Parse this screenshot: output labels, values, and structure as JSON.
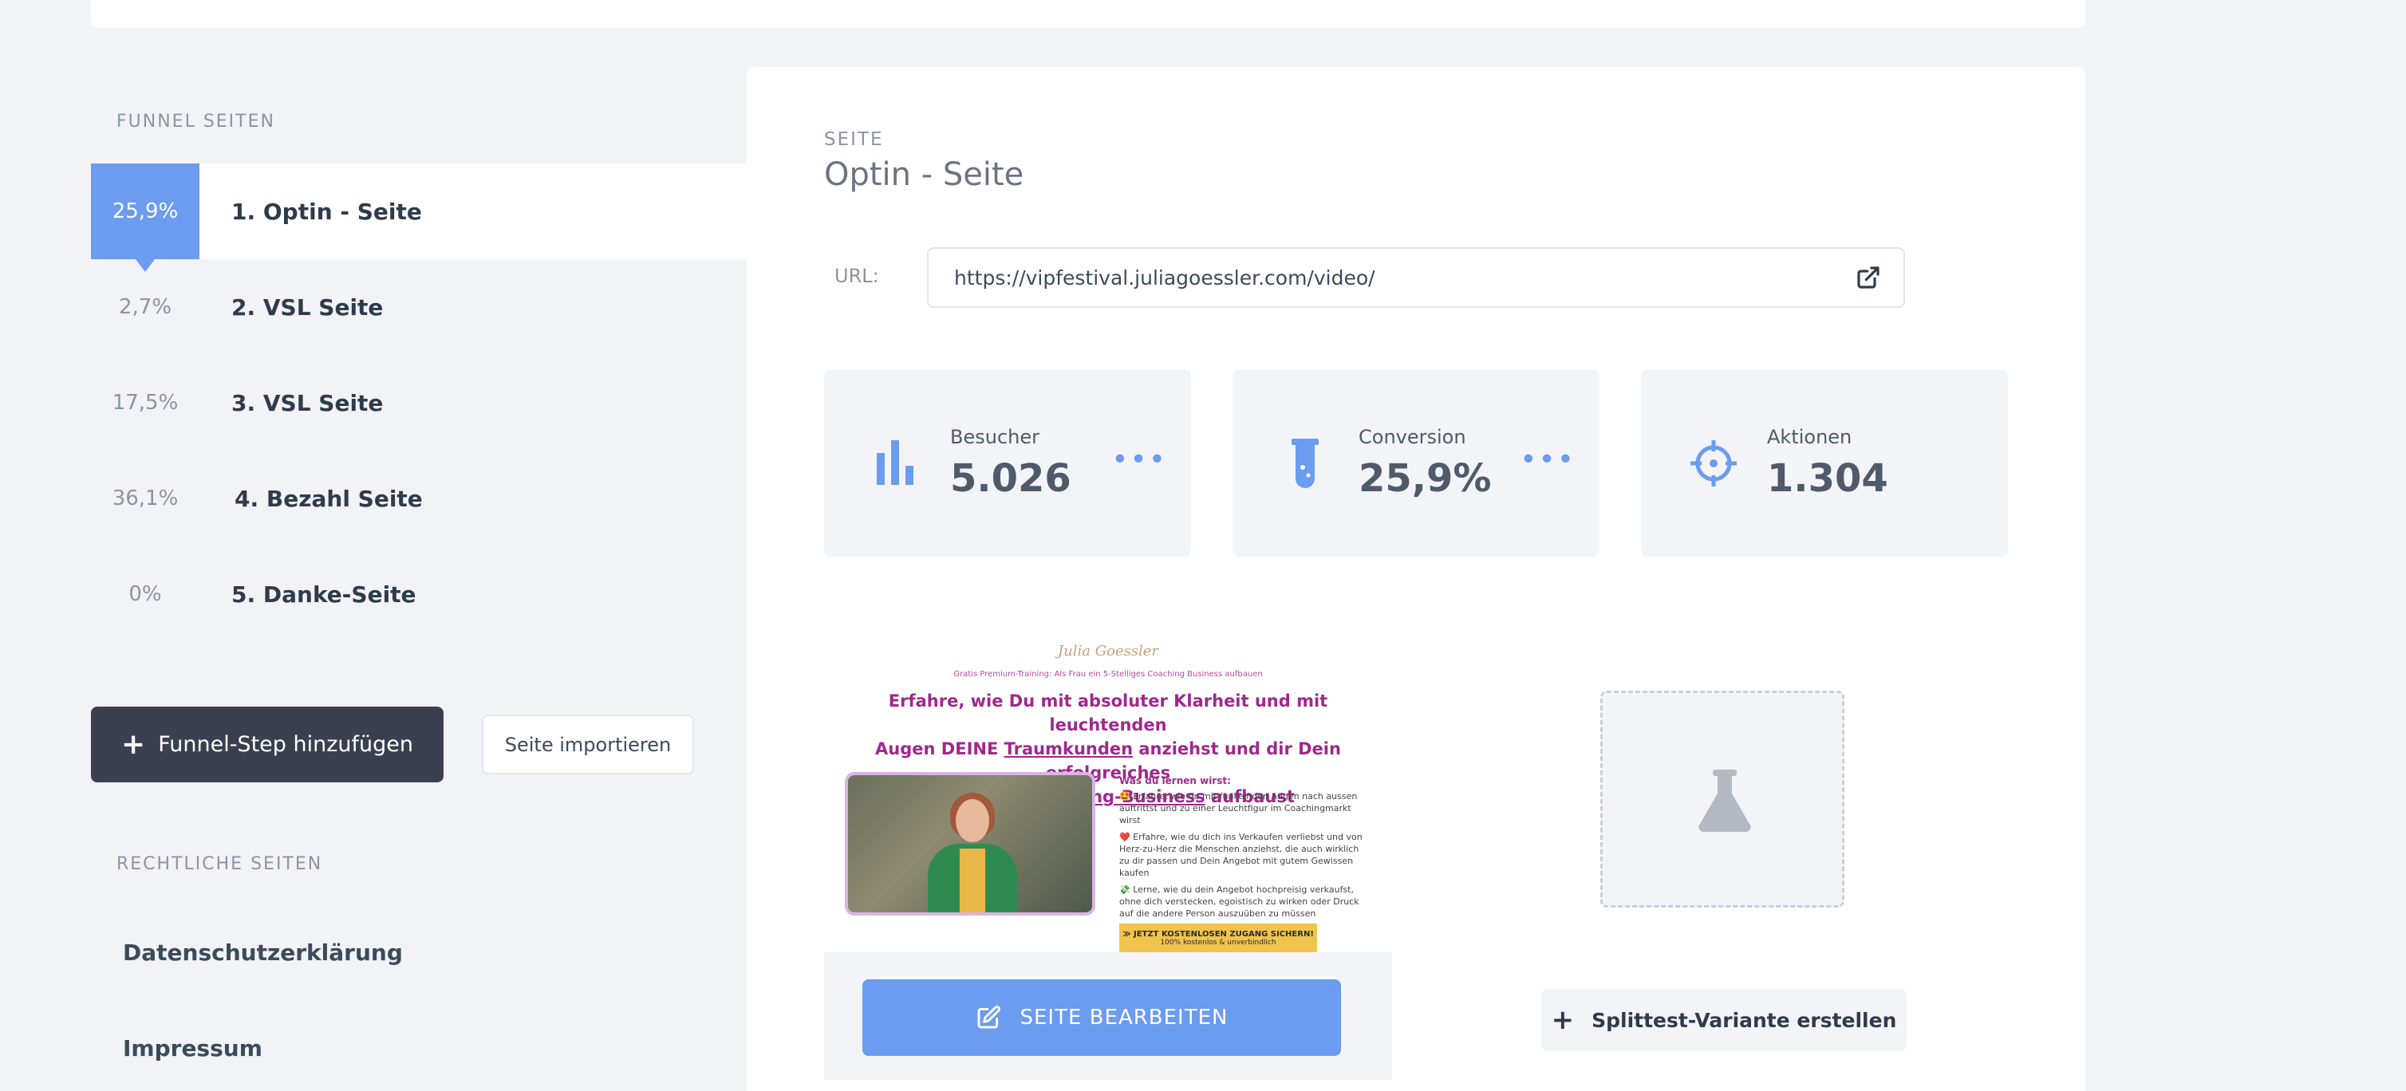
{
  "sidebar": {
    "funnel_section_label": "FUNNEL SEITEN",
    "funnel_items": [
      {
        "pct": "25,9%",
        "label": "1. Optin - Seite"
      },
      {
        "pct": "2,7%",
        "label": "2. VSL Seite"
      },
      {
        "pct": "17,5%",
        "label": "3. VSL Seite"
      },
      {
        "pct": "36,1%",
        "label": "4. Bezahl Seite"
      },
      {
        "pct": "0%",
        "label": "5. Danke-Seite"
      }
    ],
    "add_step_label": "Funnel-Step hinzufügen",
    "import_label": "Seite importieren",
    "legal_section_label": "RECHTLICHE SEITEN",
    "legal_items": [
      "Datenschutzerklärung",
      "Impressum"
    ]
  },
  "main": {
    "kicker": "SEITE",
    "title": "Optin - Seite",
    "url_label": "URL:",
    "url_value": "https://vipfestival.juliagoessler.com/video/",
    "stats": [
      {
        "label": "Besucher",
        "value": "5.026",
        "icon": "bar-chart-icon"
      },
      {
        "label": "Conversion",
        "value": "25,9%",
        "icon": "test-tube-icon"
      },
      {
        "label": "Aktionen",
        "value": "1.304",
        "icon": "crosshair-icon"
      }
    ],
    "edit_label": "SEITE BEARBEITEN",
    "split_label": "Splittest-Variante erstellen",
    "accent_color": "#6c9cf0"
  },
  "preview": {
    "logo": "Julia Goessler",
    "subline": "Gratis Premium-Training: Als Frau ein 5-Stelliges Coaching Business aufbauen",
    "headline_1": "Erfahre, wie Du mit absoluter Klarheit und mit leuchtenden",
    "headline_2a": "Augen DEINE ",
    "headline_2b": "Traumkunden",
    "headline_2c": " anziehst und dir Dein erfolgreiches",
    "headline_3a": "5-Stelliges Coaching-Business",
    "headline_3b": " aufbaust",
    "learn_title": "Was du lernen wirst:",
    "learn_items": [
      "🤩 Erfahre, wie du mit funkelnden Augen nach aussen auftrittst und zu einer Leuchtfigur im Coachingmarkt wirst",
      "❤️ Erfahre, wie du dich ins Verkaufen verliebst und von Herz-zu-Herz die Menschen anziehst, die auch wirklich zu dir passen und Dein Angebot mit gutem Gewissen kaufen",
      "💸 Lerne, wie du dein Angebot hochpreisig verkaufst, ohne dich verstecken, egoistisch zu wirken oder Druck auf die andere Person auszuüben zu müssen"
    ],
    "cta": "≫ JETZT KOSTENLOSEN ZUGANG SICHERN!",
    "cta_sub": "100% kostenlos & unverbindlich"
  }
}
